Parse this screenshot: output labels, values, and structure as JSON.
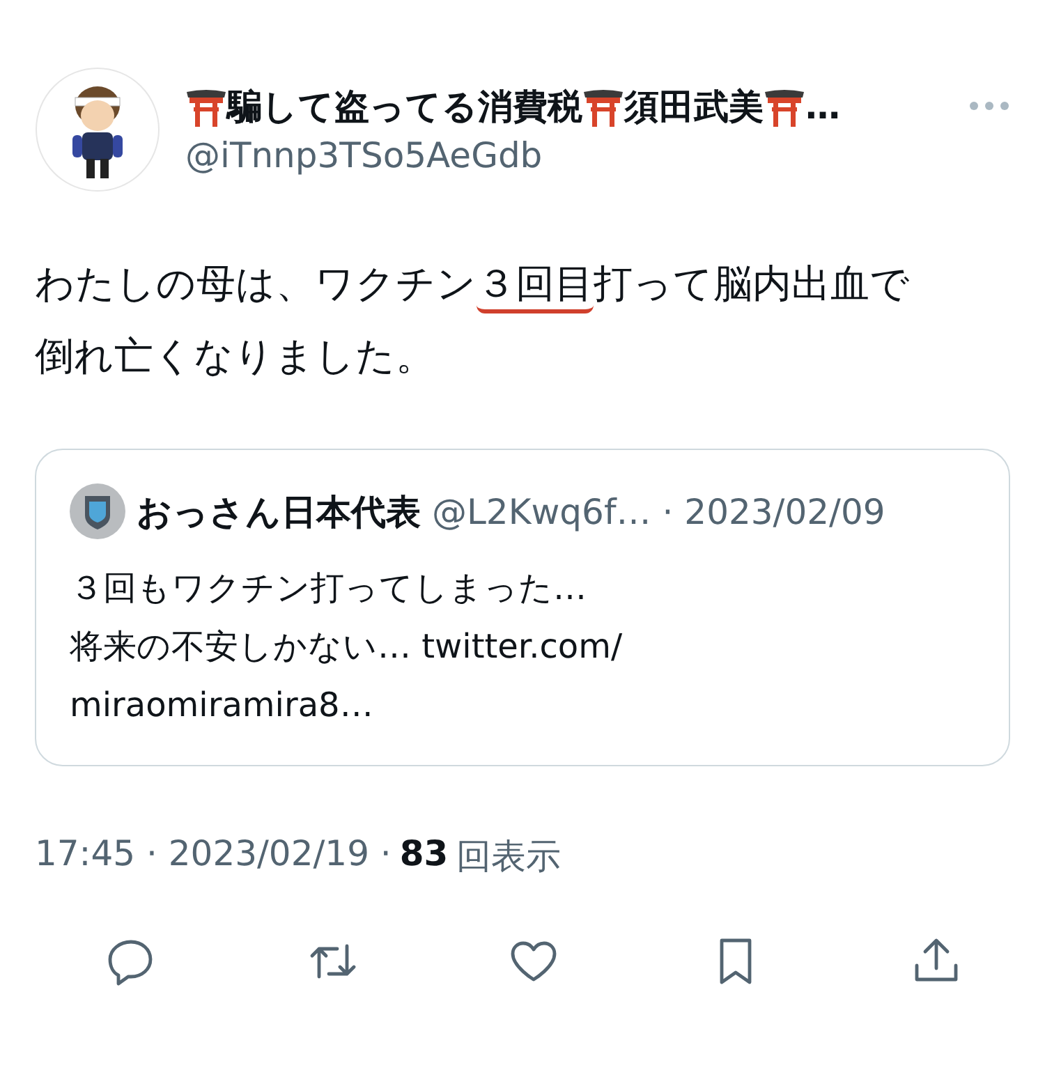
{
  "author": {
    "name_parts": [
      "騙して盗ってる消費税",
      "須田武美",
      "…"
    ],
    "handle": "@iTnnp3TSo5AeGdb"
  },
  "body": {
    "lines": [
      [
        {
          "text": "わたしの母は、ワクチン",
          "underlined": false
        },
        {
          "text": "３回目",
          "underlined": true
        },
        {
          "text": "打って脳内出血で",
          "underlined": false
        }
      ],
      [
        {
          "text": "倒れ亡くなりました。",
          "underlined": false
        }
      ]
    ]
  },
  "quote": {
    "name": "おっさん日本代表",
    "handle": "@L2Kwq6f…",
    "date": "· 2023/02/09",
    "lines": [
      "３回もワクチン打ってしまった…",
      "将来の不安しかない… twitter.com/",
      "miraomiramira8…"
    ]
  },
  "meta": {
    "time": "17:45 · 2023/02/19 ·",
    "views": "83",
    "views_label": "回表示"
  },
  "actions": [
    {
      "kind": "reply"
    },
    {
      "kind": "retweet"
    },
    {
      "kind": "like"
    },
    {
      "kind": "bookmark"
    },
    {
      "kind": "share"
    }
  ]
}
